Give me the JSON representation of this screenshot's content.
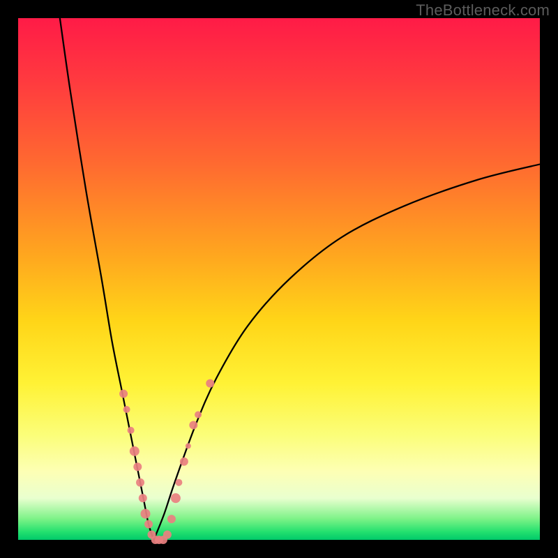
{
  "watermark": "TheBottleneck.com",
  "gradient_colors": {
    "top": "#ff1b47",
    "mid_orange": "#ffa51f",
    "mid_yellow": "#fff235",
    "pale": "#fdffb5",
    "green": "#00c96a"
  },
  "chart_data": {
    "type": "line",
    "title": "",
    "xlabel": "",
    "ylabel": "",
    "xlim": [
      0,
      100
    ],
    "ylim": [
      0,
      100
    ],
    "curves_description": "Two black curves on a thermal gradient background forming an asymmetric V. Left branch: starts near (8,100) and descends steeply to a minimum near (26,0). Right branch: rises from (26,0) with decreasing slope toward (100,72). Pink marker clusters lie on the lower portions of both branches.",
    "series": [
      {
        "name": "left_branch",
        "x": [
          8,
          10,
          13,
          16,
          18,
          20,
          22,
          24,
          25,
          26
        ],
        "y": [
          100,
          86,
          67,
          50,
          38,
          28,
          18,
          8,
          3,
          0
        ]
      },
      {
        "name": "right_branch",
        "x": [
          26,
          28,
          30,
          34,
          38,
          44,
          52,
          62,
          74,
          88,
          100
        ],
        "y": [
          0,
          5,
          11,
          22,
          31,
          41,
          50,
          58,
          64,
          69,
          72
        ]
      }
    ],
    "markers": [
      {
        "branch": "left",
        "x": 20.2,
        "y": 28,
        "r": 6
      },
      {
        "branch": "left",
        "x": 20.8,
        "y": 25,
        "r": 5
      },
      {
        "branch": "left",
        "x": 21.6,
        "y": 21,
        "r": 5
      },
      {
        "branch": "left",
        "x": 22.3,
        "y": 17,
        "r": 7
      },
      {
        "branch": "left",
        "x": 22.9,
        "y": 14,
        "r": 6
      },
      {
        "branch": "left",
        "x": 23.4,
        "y": 11,
        "r": 6
      },
      {
        "branch": "left",
        "x": 23.9,
        "y": 8,
        "r": 6
      },
      {
        "branch": "left",
        "x": 24.4,
        "y": 5,
        "r": 7
      },
      {
        "branch": "left",
        "x": 25.0,
        "y": 3,
        "r": 6
      },
      {
        "branch": "left",
        "x": 25.6,
        "y": 1,
        "r": 6
      },
      {
        "branch": "bottom",
        "x": 26.3,
        "y": 0,
        "r": 6
      },
      {
        "branch": "bottom",
        "x": 27.0,
        "y": 0,
        "r": 6
      },
      {
        "branch": "bottom",
        "x": 27.8,
        "y": 0,
        "r": 6
      },
      {
        "branch": "bottom",
        "x": 28.6,
        "y": 1,
        "r": 6
      },
      {
        "branch": "right",
        "x": 29.4,
        "y": 4,
        "r": 6
      },
      {
        "branch": "right",
        "x": 30.2,
        "y": 8,
        "r": 7
      },
      {
        "branch": "right",
        "x": 30.8,
        "y": 11,
        "r": 5
      },
      {
        "branch": "right",
        "x": 31.8,
        "y": 15,
        "r": 6
      },
      {
        "branch": "right",
        "x": 32.6,
        "y": 18,
        "r": 4
      },
      {
        "branch": "right",
        "x": 33.6,
        "y": 22,
        "r": 6
      },
      {
        "branch": "right",
        "x": 34.5,
        "y": 24,
        "r": 5
      },
      {
        "branch": "right",
        "x": 36.8,
        "y": 30,
        "r": 6
      }
    ]
  }
}
